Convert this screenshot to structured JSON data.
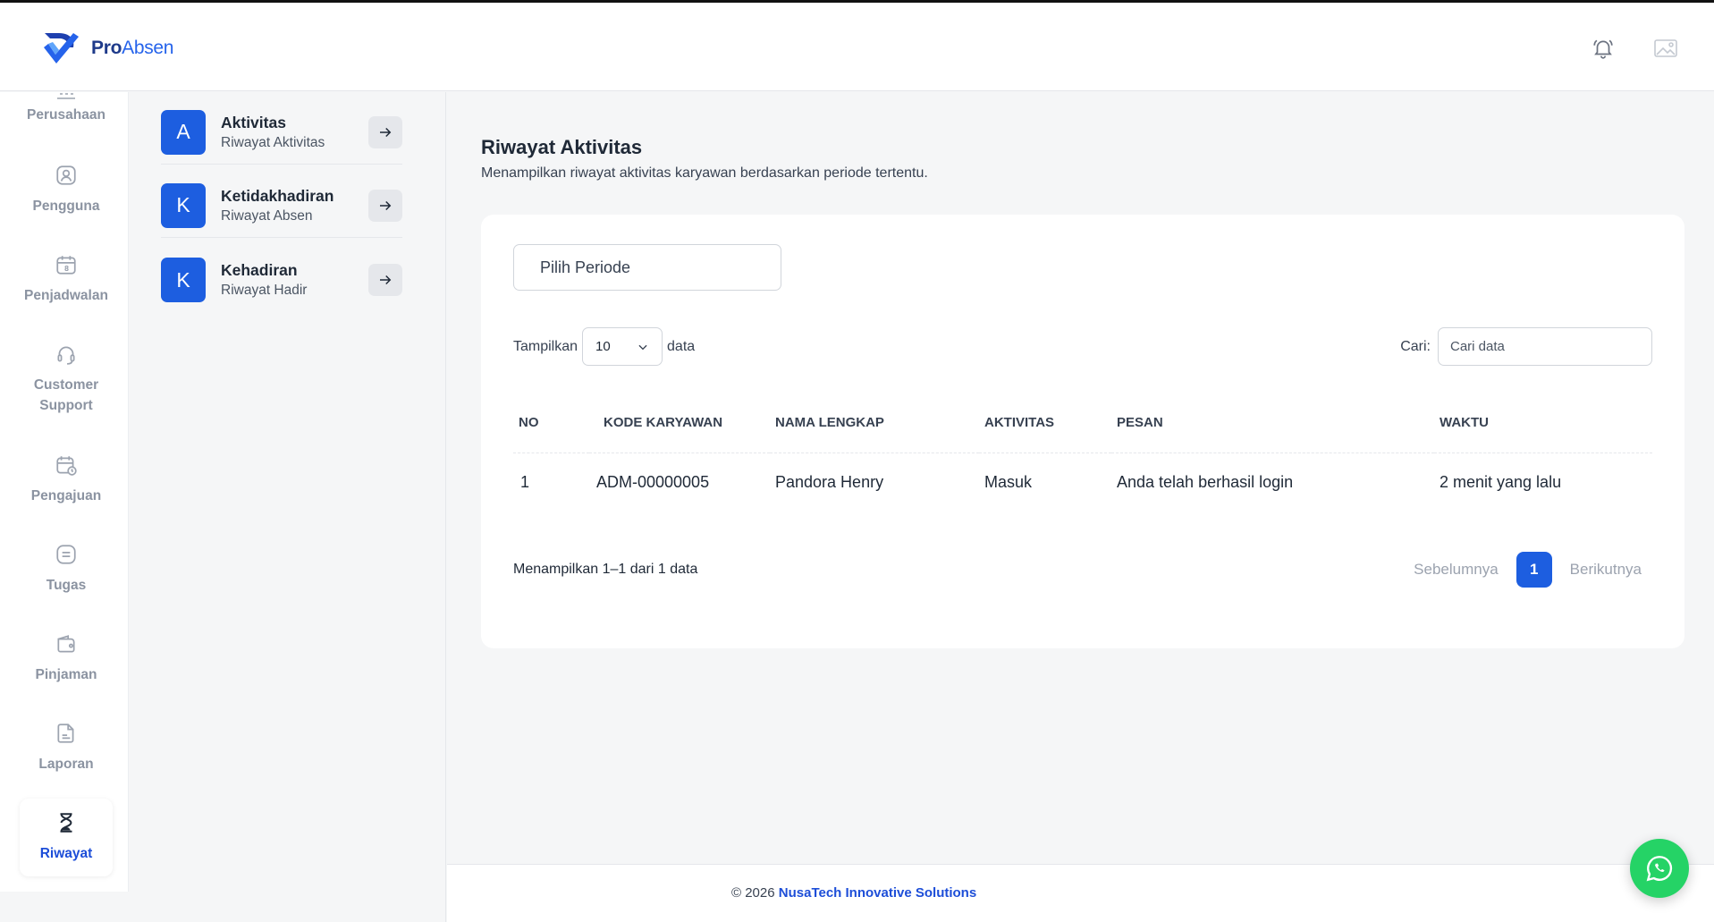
{
  "brand": {
    "name_bold": "Pro",
    "name_regular": "Absen"
  },
  "rail": {
    "items": [
      {
        "label": "Perusahaan",
        "icon": "building-icon"
      },
      {
        "label": "Pengguna",
        "icon": "user-icon"
      },
      {
        "label": "Penjadwalan",
        "icon": "calendar-icon"
      },
      {
        "label": "Customer Support",
        "icon": "headset-icon"
      },
      {
        "label": "Pengajuan",
        "icon": "calendar-clock-icon"
      },
      {
        "label": "Tugas",
        "icon": "clipboard-icon"
      },
      {
        "label": "Pinjaman",
        "icon": "wallet-icon"
      },
      {
        "label": "Laporan",
        "icon": "document-icon"
      },
      {
        "label": "Riwayat",
        "icon": "hourglass-icon",
        "active": true
      }
    ]
  },
  "submenu": {
    "items": [
      {
        "badge": "A",
        "title": "Aktivitas",
        "desc": "Riwayat Aktivitas"
      },
      {
        "badge": "K",
        "title": "Ketidakhadiran",
        "desc": "Riwayat Absen"
      },
      {
        "badge": "K",
        "title": "Kehadiran",
        "desc": "Riwayat Hadir"
      }
    ]
  },
  "page": {
    "title": "Riwayat Aktivitas",
    "subtitle": "Menampilkan riwayat aktivitas karyawan berdasarkan periode tertentu."
  },
  "filter": {
    "periode_label": "Pilih Periode",
    "show_prefix": "Tampilkan",
    "show_value": "10",
    "show_suffix": "data",
    "search_label": "Cari:",
    "search_placeholder": "Cari data"
  },
  "table": {
    "columns": [
      "NO",
      "KODE KARYAWAN",
      "NAMA LENGKAP",
      "AKTIVITAS",
      "PESAN",
      "WAKTU"
    ],
    "rows": [
      [
        "1",
        "ADM-00000005",
        "Pandora Henry",
        "Masuk",
        "Anda telah berhasil login",
        "2 menit yang lalu"
      ]
    ]
  },
  "pagination": {
    "info": "Menampilkan 1–1 dari 1 data",
    "prev": "Sebelumnya",
    "current": "1",
    "next": "Berikutnya"
  },
  "footer": {
    "prefix": "© 2026 ",
    "company": "NusaTech Innovative Solutions"
  },
  "colors": {
    "primary": "#1d5ee0",
    "whatsapp": "#25d366"
  }
}
